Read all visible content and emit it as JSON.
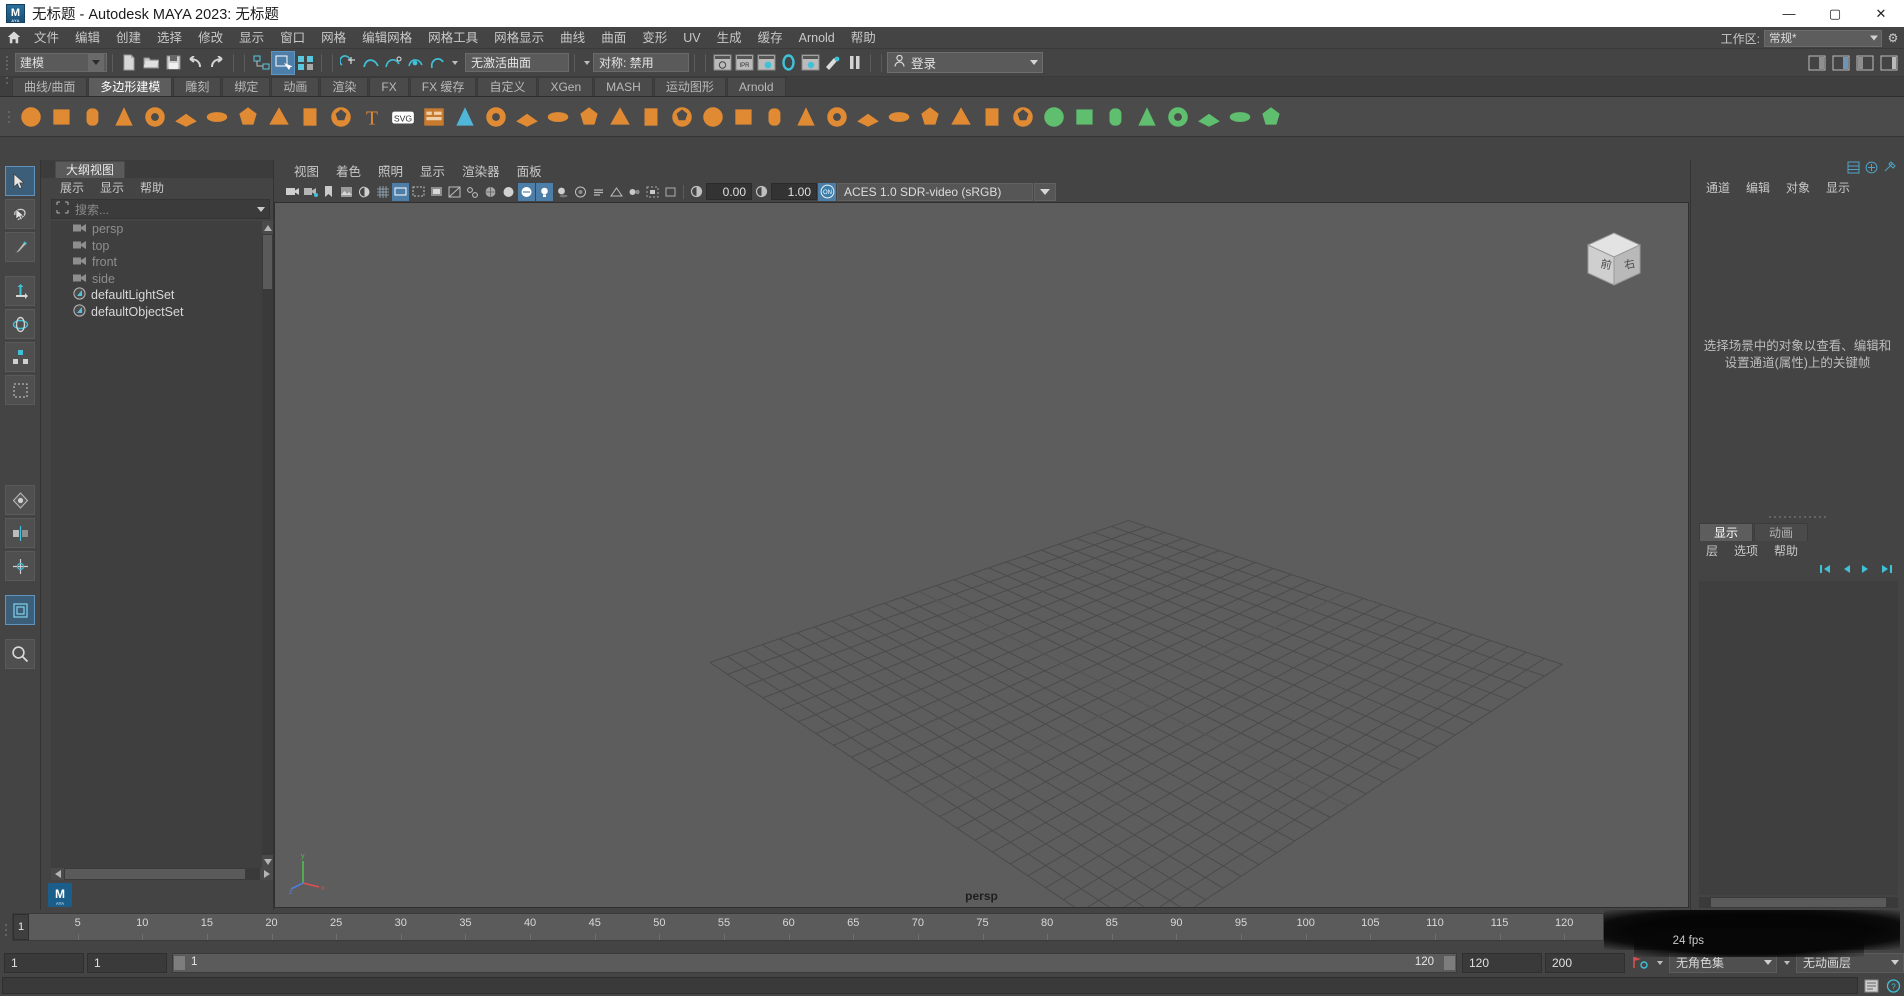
{
  "window": {
    "title": "无标题 - Autodesk MAYA 2023: 无标题",
    "logo_text": "M",
    "logo_sub": "AYA",
    "minimize": "—",
    "maximize": "▢",
    "close": "✕"
  },
  "menubar": {
    "home_icon": "home-icon",
    "items": [
      "文件",
      "编辑",
      "创建",
      "选择",
      "修改",
      "显示",
      "窗口",
      "网格",
      "编辑网格",
      "网格工具",
      "网格显示",
      "曲线",
      "曲面",
      "变形",
      "UV",
      "生成",
      "缓存",
      "Arnold",
      "帮助"
    ],
    "workspace_label": "工作区:",
    "workspace_value": "常规*"
  },
  "statusline": {
    "mode_value": "建模",
    "new_scene_icon": "new-file-icon",
    "open_scene_icon": "open-folder-icon",
    "save_scene_icon": "save-disk-icon",
    "undo_icon": "undo-arrow-icon",
    "redo_icon": "redo-arrow-icon",
    "select_hierarchy_icon": "select-hierarchy-icon",
    "select_object_icon": "select-object-icon",
    "select_component_icon": "select-component-icon",
    "snap_grid_icon": "snap-to-grid-icon",
    "snap_curve_icon": "snap-to-curve-icon",
    "snap_point_icon": "snap-to-point-icon",
    "snap_projectcenter_icon": "snap-to-projected-center-icon",
    "snap_viewplane_icon": "snap-to-view-plane-icon",
    "surface_field": "无激活曲面",
    "symmetry_field": "对称: 禁用",
    "render_current_icon": "render-current-frame-icon",
    "ipr_icon": "ipr-render-icon",
    "render_settings_icon": "render-settings-icon",
    "hypershade_icon": "hypershade-icon",
    "render_view_icon": "render-view-icon",
    "light_icon": "rendering-flags-icon",
    "pause_icon": "pause-icon",
    "login_label": "登录",
    "login_user_icon": "user-icon",
    "right_icons": [
      "show-hide-modeling-toolkit-icon",
      "show-hide-attribute-editor-icon",
      "show-hide-tool-settings-icon",
      "show-hide-channel-box-icon"
    ]
  },
  "shelf": {
    "tabs": [
      "曲线/曲面",
      "多边形建模",
      "雕刻",
      "绑定",
      "动画",
      "渲染",
      "FX",
      "FX 缓存",
      "自定义",
      "XGen",
      "MASH",
      "运动图形",
      "Arnold"
    ],
    "active_tab": "多边形建模",
    "icons": [
      "polygon-sphere-icon",
      "polygon-cube-icon",
      "polygon-cylinder-icon",
      "polygon-cone-icon",
      "polygon-torus-icon",
      "polygon-plane-icon",
      "polygon-disc-icon",
      "polygon-platonic-icon",
      "polygon-pyramid-icon",
      "polygon-prism-icon",
      "polygon-soccerball-icon",
      "text-tool-icon",
      "svg-tool-icon",
      "type-tool-icon",
      "boolean-icon",
      "combine-icon",
      "separate-icon",
      "extrude-icon",
      "bevel-icon",
      "bridge-icon",
      "append-icon",
      "smooth-icon",
      "triangulate-icon",
      "quadrangulate-icon",
      "mirror-icon",
      "multicut-icon",
      "target-weld-icon",
      "connect-icon",
      "crease-icon",
      "insert-edge-loop-icon",
      "offset-edge-loop-icon",
      "slide-edge-icon",
      "sculpt-icon",
      "uv-editor-icon",
      "uv-planar-icon",
      "uv-cylindrical-icon",
      "uv-spherical-icon",
      "uv-automatic-icon",
      "uv-camera-icon",
      "uv-layout-icon",
      "uv-unfold-icon"
    ]
  },
  "tool_column": {
    "items": [
      "select-tool-icon",
      "lasso-select-tool-icon",
      "paint-select-tool-icon",
      "move-tool-icon",
      "rotate-tool-icon",
      "scale-tool-icon",
      "last-tool-icon",
      "soft-select-icon",
      "symmetry-icon",
      "show-manipulator-tool-icon",
      "magnifier-icon"
    ],
    "selected": "show-manipulator-tool-icon"
  },
  "outliner": {
    "tab_label": "大纲视图",
    "menus": [
      "展示",
      "显示",
      "帮助"
    ],
    "search_placeholder": "搜索...",
    "search_icon": "outliner-filter-icon",
    "items": [
      {
        "label": "persp",
        "icon": "camera-icon",
        "dim": true
      },
      {
        "label": "top",
        "icon": "camera-icon",
        "dim": true
      },
      {
        "label": "front",
        "icon": "camera-icon",
        "dim": true
      },
      {
        "label": "side",
        "icon": "camera-icon",
        "dim": true
      },
      {
        "label": "defaultLightSet",
        "icon": "set-icon",
        "dim": false
      },
      {
        "label": "defaultObjectSet",
        "icon": "set-icon",
        "dim": false
      }
    ]
  },
  "viewport": {
    "menus": [
      "视图",
      "着色",
      "照明",
      "显示",
      "渲染器",
      "面板"
    ],
    "camera_label": "persp",
    "gamma_value": "0.00",
    "exposure_value": "1.00",
    "colorspace": "ACES 1.0 SDR-video (sRGB)",
    "colorspace_toggle_icon": "color-management-on-icon",
    "toolbar_icons": [
      "select-camera-icon",
      "camera-attributes-icon",
      "bookmark-icon",
      "image-plane-icon",
      "two-sided-lighting-icon",
      "grid-toggle-icon",
      "film-gate-icon",
      "resolution-gate-icon",
      "gate-mask-icon",
      "xray-icon",
      "xray-joints-icon",
      "wireframe-on-shaded-icon",
      "smooth-shade-all-icon",
      "hardware-texturing-icon",
      "use-default-lighting-icon",
      "shadows-icon",
      "screen-space-ao-icon",
      "motion-blur-icon",
      "multisample-aa-icon",
      "depth-of-field-icon",
      "isolate-select-icon",
      "xray-toggle-icon",
      "exposure-icon",
      "gamma-icon"
    ],
    "viewcube_front": "前",
    "viewcube_right": "右",
    "axis_x": "x",
    "axis_y": "y",
    "axis_z": "z"
  },
  "right_panel": {
    "menus": [
      "通道",
      "编辑",
      "对象",
      "显示"
    ],
    "top_icons": [
      "channel-box-icon",
      "attribute-editor-icon",
      "modeling-toolkit-icon"
    ],
    "empty_message": "选择场景中的对象以查看、编辑和设置通道(属性)上的关键帧",
    "layer_tabs": [
      "显示",
      "动画"
    ],
    "layer_active_tab": "显示",
    "layer_menus": [
      "层",
      "选项",
      "帮助"
    ],
    "layer_buttons": [
      "layer-first-icon",
      "layer-prev-icon",
      "layer-next-icon",
      "layer-last-icon"
    ]
  },
  "timeline": {
    "current_frame": "1",
    "ticks": [
      {
        "label": "5",
        "frame": 5
      },
      {
        "label": "10",
        "frame": 10
      },
      {
        "label": "15",
        "frame": 15
      },
      {
        "label": "20",
        "frame": 20
      },
      {
        "label": "25",
        "frame": 25
      },
      {
        "label": "30",
        "frame": 30
      },
      {
        "label": "35",
        "frame": 35
      },
      {
        "label": "40",
        "frame": 40
      },
      {
        "label": "45",
        "frame": 45
      },
      {
        "label": "50",
        "frame": 50
      },
      {
        "label": "55",
        "frame": 55
      },
      {
        "label": "60",
        "frame": 60
      },
      {
        "label": "65",
        "frame": 65
      },
      {
        "label": "70",
        "frame": 70
      },
      {
        "label": "75",
        "frame": 75
      },
      {
        "label": "80",
        "frame": 80
      },
      {
        "label": "85",
        "frame": 85
      },
      {
        "label": "90",
        "frame": 90
      },
      {
        "label": "95",
        "frame": 95
      },
      {
        "label": "100",
        "frame": 100
      },
      {
        "label": "105",
        "frame": 105
      },
      {
        "label": "110",
        "frame": 110
      },
      {
        "label": "115",
        "frame": 115
      },
      {
        "label": "120",
        "frame": 120
      }
    ],
    "range_start_min": "1",
    "range_start": "1",
    "range_slider_left_value": "1",
    "range_slider_right_value": "120",
    "range_end": "120",
    "range_end_max": "200",
    "anim_prefs_icon": "animation-preferences-icon",
    "character_set": "无角色集",
    "anim_layer": "无动画层",
    "fps_label": "24 fps",
    "playback_icons": [
      "go-to-start-icon",
      "step-back-key-icon",
      "step-back-frame-icon",
      "play-backwards-icon",
      "play-forwards-icon",
      "step-forward-frame-icon",
      "step-forward-key-icon",
      "go-to-end-icon",
      "auto-key-icon"
    ]
  },
  "colors": {
    "accent_blue": "#4c7ea8",
    "panel_bg": "#444444",
    "viewport_bg": "#5d5d5d",
    "field_bg": "#3a3a3a",
    "text": "#c8c8c8"
  }
}
